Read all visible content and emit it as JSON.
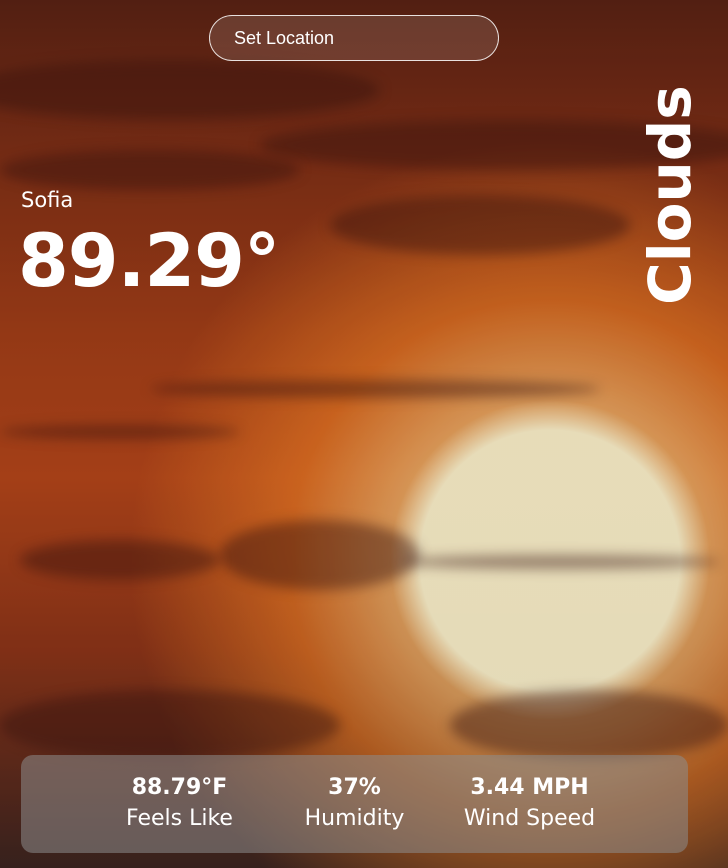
{
  "search": {
    "placeholder": "Set Location"
  },
  "weather": {
    "city": "Sofia",
    "temperature": "89.29°",
    "condition": "Clouds"
  },
  "stats": [
    {
      "value": "88.79°F",
      "label": "Feels Like"
    },
    {
      "value": "37%",
      "label": "Humidity"
    },
    {
      "value": "3.44 MPH",
      "label": "Wind Speed"
    }
  ],
  "colors": {
    "text": "#ffffff",
    "stats_panel": "#8c8c8c",
    "sky_top": "#5a2214",
    "sky_mid": "#b2451a",
    "sun": "#fff8d2"
  }
}
